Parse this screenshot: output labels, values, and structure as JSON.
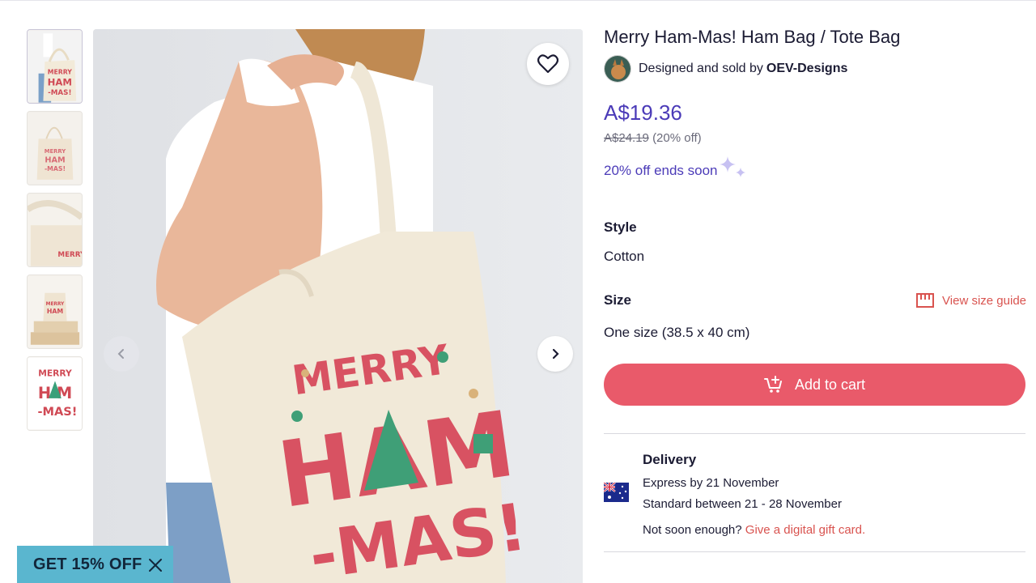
{
  "product": {
    "title": "Merry Ham-Mas! Ham Bag / Tote Bag",
    "seller_prefix": "Designed and sold by",
    "seller_name": "OEV-Designs"
  },
  "pricing": {
    "price": "A$19.36",
    "old_price": "A$24.19",
    "discount": "(20% off)",
    "sale_ends": "20% off ends soon"
  },
  "options": {
    "style_label": "Style",
    "style_value": "Cotton",
    "size_label": "Size",
    "size_guide_label": "View size guide",
    "size_value": "One size (38.5 x 40 cm)"
  },
  "cart": {
    "add_label": "Add to cart"
  },
  "delivery": {
    "title": "Delivery",
    "express": "Express by 21 November",
    "standard": "Standard between 21 - 28 November",
    "gift_prefix": "Not soon enough?",
    "gift_link": "Give a digital gift card."
  },
  "promo": {
    "label": "GET 15% OFF"
  },
  "gallery": {
    "thumbnail_count": 5,
    "active_index": 0
  },
  "design_text": {
    "line1": "MERRY",
    "line2": "HAM",
    "line3": "-MAS!"
  },
  "icons": [
    "heart-icon",
    "chevron-left-icon",
    "chevron-right-icon",
    "close-icon",
    "ruler-icon",
    "cart-icon",
    "sparkle-icon",
    "australia-flag-icon"
  ],
  "colors": {
    "accent": "#4b3bb8",
    "cart_button": "#e95a6a",
    "link": "#d9534f",
    "promo_bg": "#5ab6cf"
  }
}
